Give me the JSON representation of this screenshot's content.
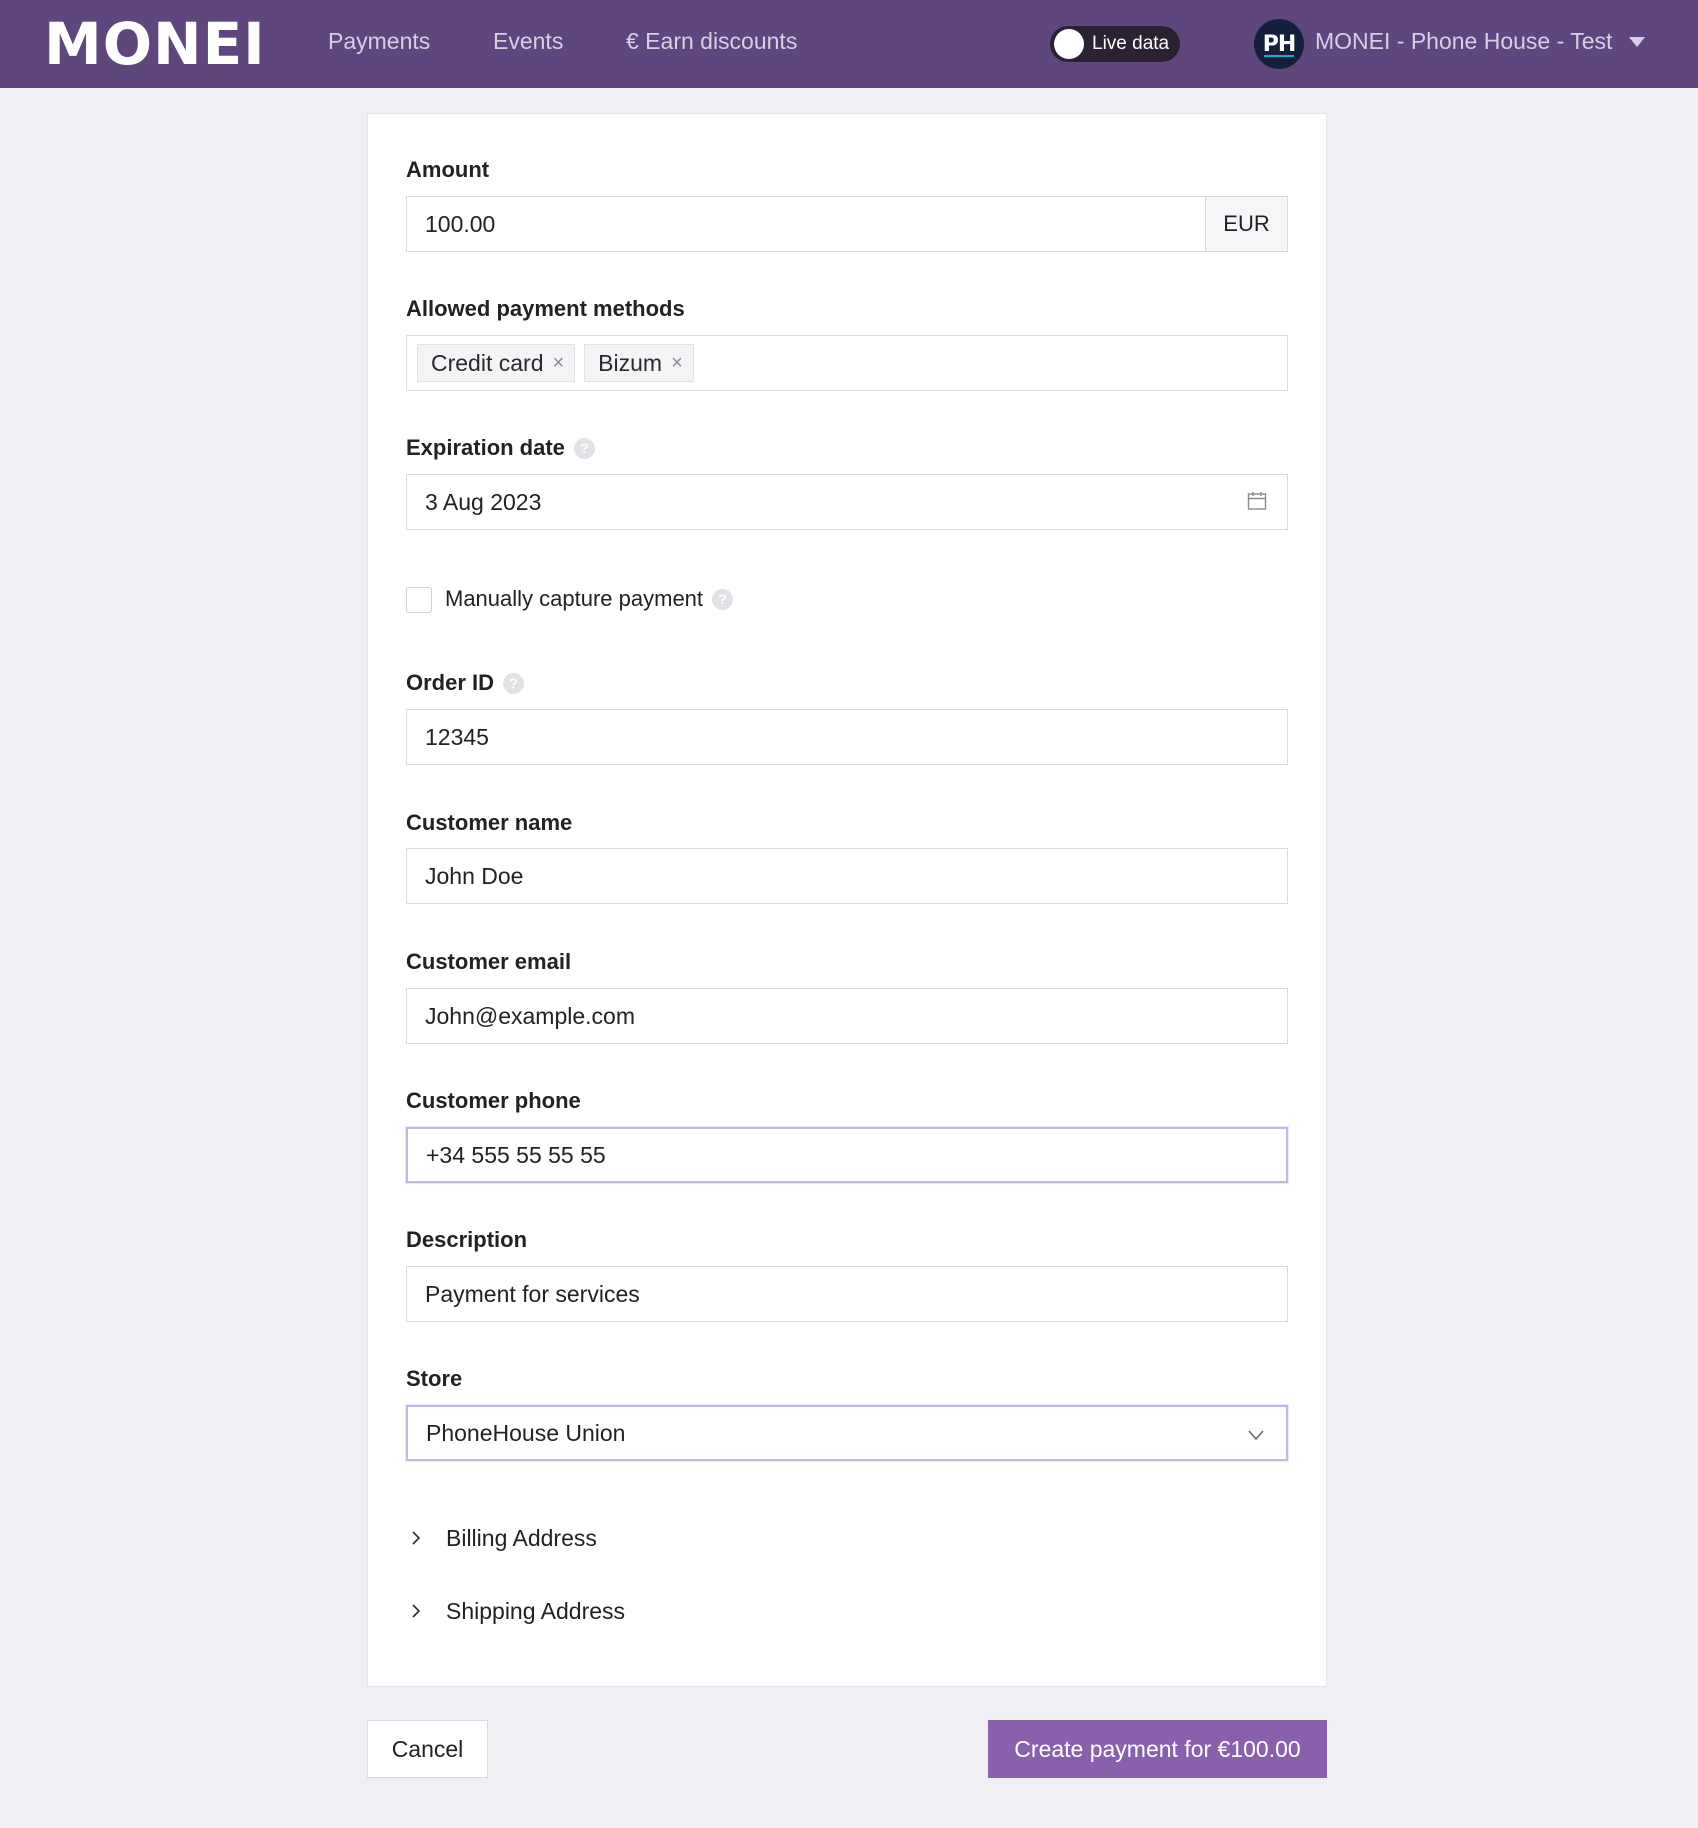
{
  "colors": {
    "header_bg": "#5f467c",
    "primary_button": "#8960ac",
    "page_bg": "#f0f0f4"
  },
  "header": {
    "logo": "MONEI",
    "nav": [
      "Payments",
      "Events",
      "€ Earn discounts"
    ],
    "live_toggle_label": "Live data",
    "live_toggle_on": false,
    "avatar_initials": "PH",
    "account_name": "MONEI - Phone House - Test",
    "account_menu_icon": "caret-down-icon"
  },
  "form": {
    "amount": {
      "label": "Amount",
      "value": "100.00",
      "currency": "EUR"
    },
    "payment_methods": {
      "label": "Allowed payment methods",
      "tags": [
        "Credit card",
        "Bizum"
      ],
      "remove_icon": "×"
    },
    "expiration_date": {
      "label": "Expiration date",
      "value": "3 Aug 2023",
      "help_icon": "?"
    },
    "manual_capture": {
      "label": "Manually capture payment",
      "checked": false
    },
    "order_id": {
      "label": "Order ID",
      "value": "12345"
    },
    "customer_name": {
      "label": "Customer name",
      "value": "John Doe"
    },
    "customer_email": {
      "label": "Customer email",
      "value": "John@example.com"
    },
    "customer_phone": {
      "label": "Customer phone",
      "value": "+34 555 55 55 55"
    },
    "description": {
      "label": "Description",
      "value": "Payment for services"
    },
    "store": {
      "label": "Store",
      "value": "PhoneHouse Union"
    },
    "billing_address": "Billing Address",
    "shipping_address": "Shipping Address"
  },
  "actions": {
    "cancel": "Cancel",
    "create": "Create payment for €100.00"
  }
}
